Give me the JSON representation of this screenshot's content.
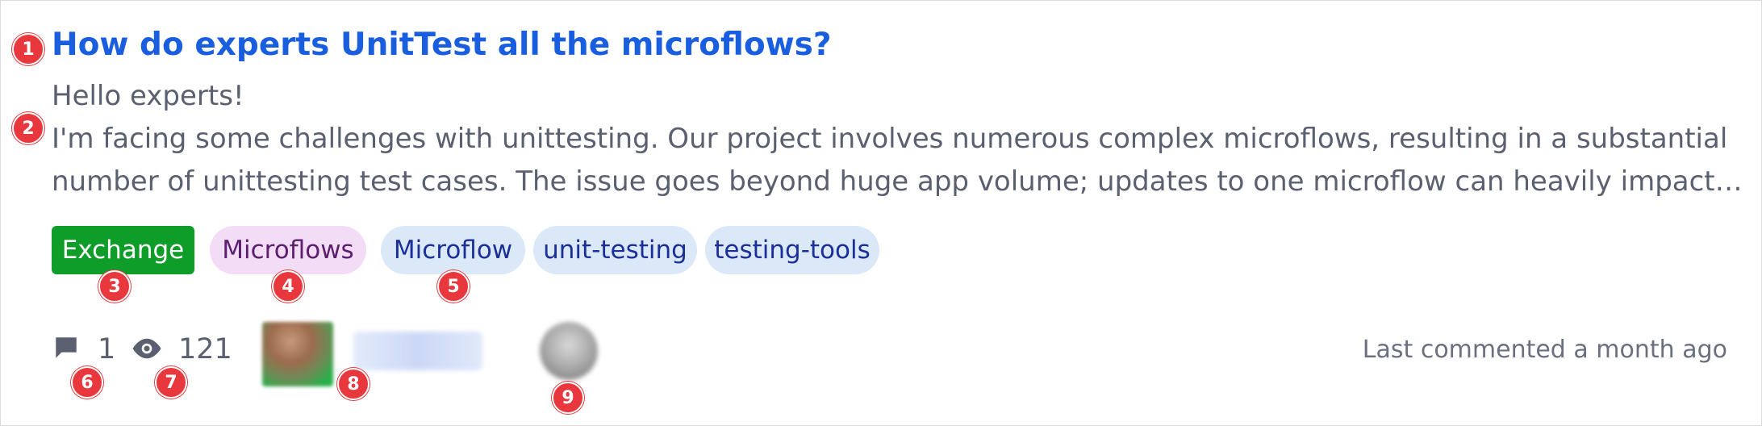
{
  "post": {
    "title": "How do experts UnitTest all the microflows?",
    "excerpt": {
      "greeting": "Hello experts!",
      "line1": "I'm facing some challenges with unittesting. Our project involves numerous complex microflows, resulting in a substantial",
      "line2": "number of unittesting test cases. The issue goes beyond huge app volume; updates to one microflow can heavily impact…"
    },
    "tags": [
      {
        "label": "Exchange",
        "color": "#0f9d2a"
      },
      {
        "label": "Microflows",
        "color": "#f3dcf6"
      },
      {
        "label": "Microflow",
        "color": "#dbe8f8"
      },
      {
        "label": "unit-testing",
        "color": "#dbe8f8"
      },
      {
        "label": "testing-tools",
        "color": "#dbe8f8"
      }
    ],
    "stats": {
      "comments": "1",
      "views": "121",
      "comment_icon": "comment-icon",
      "views_icon": "eye-icon"
    },
    "last_activity": "Last commented a month ago"
  },
  "markers": [
    "1",
    "2",
    "3",
    "4",
    "5",
    "6",
    "7",
    "8",
    "9"
  ],
  "colors": {
    "title": "#1a5ee0",
    "marker": "#e8383d"
  }
}
